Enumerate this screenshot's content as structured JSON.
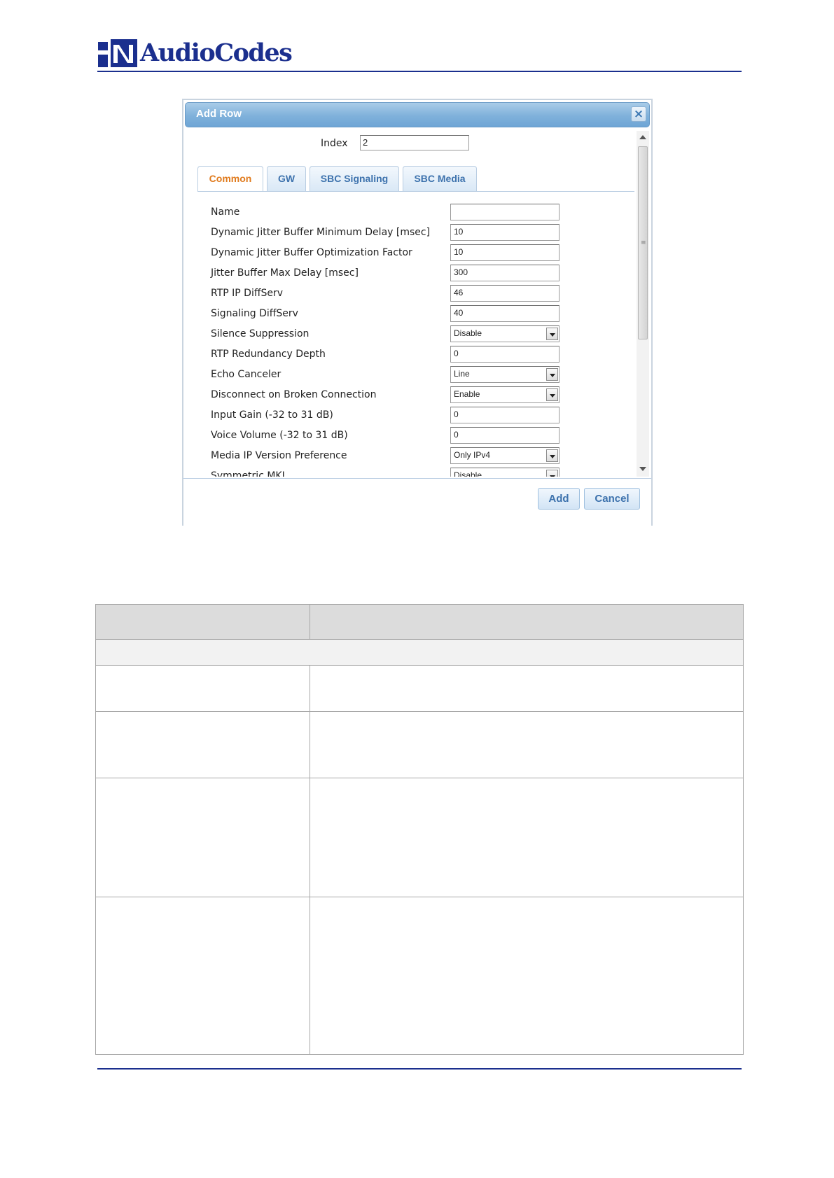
{
  "brand": {
    "logo_text": "AudioCodes",
    "color": "#1b2f8e"
  },
  "dialog": {
    "title": "Add Row",
    "close_label": "×",
    "index_label": "Index",
    "index_value": "2",
    "tabs": [
      "Common",
      "GW",
      "SBC Signaling",
      "SBC Media"
    ],
    "active_tab": "Common",
    "fields": [
      {
        "label": "Name",
        "value": "",
        "type": "text"
      },
      {
        "label": "Dynamic Jitter Buffer Minimum Delay [msec]",
        "value": "10",
        "type": "text"
      },
      {
        "label": "Dynamic Jitter Buffer Optimization Factor",
        "value": "10",
        "type": "text"
      },
      {
        "label": "Jitter Buffer Max Delay [msec]",
        "value": "300",
        "type": "text"
      },
      {
        "label": "RTP IP DiffServ",
        "value": "46",
        "type": "text"
      },
      {
        "label": "Signaling DiffServ",
        "value": "40",
        "type": "text"
      },
      {
        "label": "Silence Suppression",
        "value": "Disable",
        "type": "select"
      },
      {
        "label": "RTP Redundancy Depth",
        "value": "0",
        "type": "text"
      },
      {
        "label": "Echo Canceler",
        "value": "Line",
        "type": "select"
      },
      {
        "label": "Disconnect on Broken Connection",
        "value": "Enable",
        "type": "select"
      },
      {
        "label": "Input Gain (-32 to 31 dB)",
        "value": "0",
        "type": "text"
      },
      {
        "label": "Voice Volume (-32 to 31 dB)",
        "value": "0",
        "type": "text"
      },
      {
        "label": "Media IP Version Preference",
        "value": "Only IPv4",
        "type": "select"
      },
      {
        "label": "Symmetric MKI",
        "value": "Disable",
        "type": "select"
      }
    ],
    "add_label": "Add",
    "cancel_label": "Cancel",
    "colors": {
      "active_tab": "#e07b1e",
      "tab_text": "#3d72ad",
      "title_bar": "#7fb1db"
    }
  }
}
